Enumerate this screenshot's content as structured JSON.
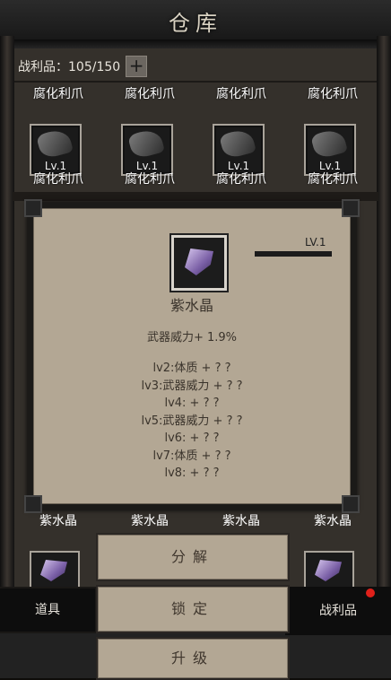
{
  "title": "仓库",
  "loot_counter": "战利品：105/150",
  "plus_symbol": "+",
  "row1_names": [
    "腐化利爪",
    "腐化利爪",
    "腐化利爪",
    "腐化利爪"
  ],
  "row2_items": [
    {
      "name": "腐化利爪",
      "level": "Lv.1"
    },
    {
      "name": "腐化利爪",
      "level": "Lv.1"
    },
    {
      "name": "腐化利爪",
      "level": "Lv.1"
    },
    {
      "name": "腐化利爪",
      "level": "Lv.1"
    }
  ],
  "popup": {
    "level": "LV.1",
    "item_name": "紫水晶",
    "base_stat": "武器威力+ 1.9%",
    "bonuses": [
      "lv2:体质 + ? ?",
      "lv3:武器威力 + ? ?",
      "lv4: + ? ?",
      "lv5:武器威力 + ? ?",
      "lv6: + ? ?",
      "lv7:体质 + ? ?",
      "lv8: + ? ?"
    ],
    "icon": "amethyst-crystal-icon"
  },
  "row3_names": [
    "紫水晶",
    "紫水晶",
    "紫水晶",
    "紫水晶"
  ],
  "actions": {
    "decompose": "分解",
    "lock": "锁定",
    "upgrade": "升级"
  },
  "nav": {
    "items": "道具",
    "loot": "战利品"
  },
  "colors": {
    "panel": "#b3a794",
    "notify": "#e0201a"
  }
}
